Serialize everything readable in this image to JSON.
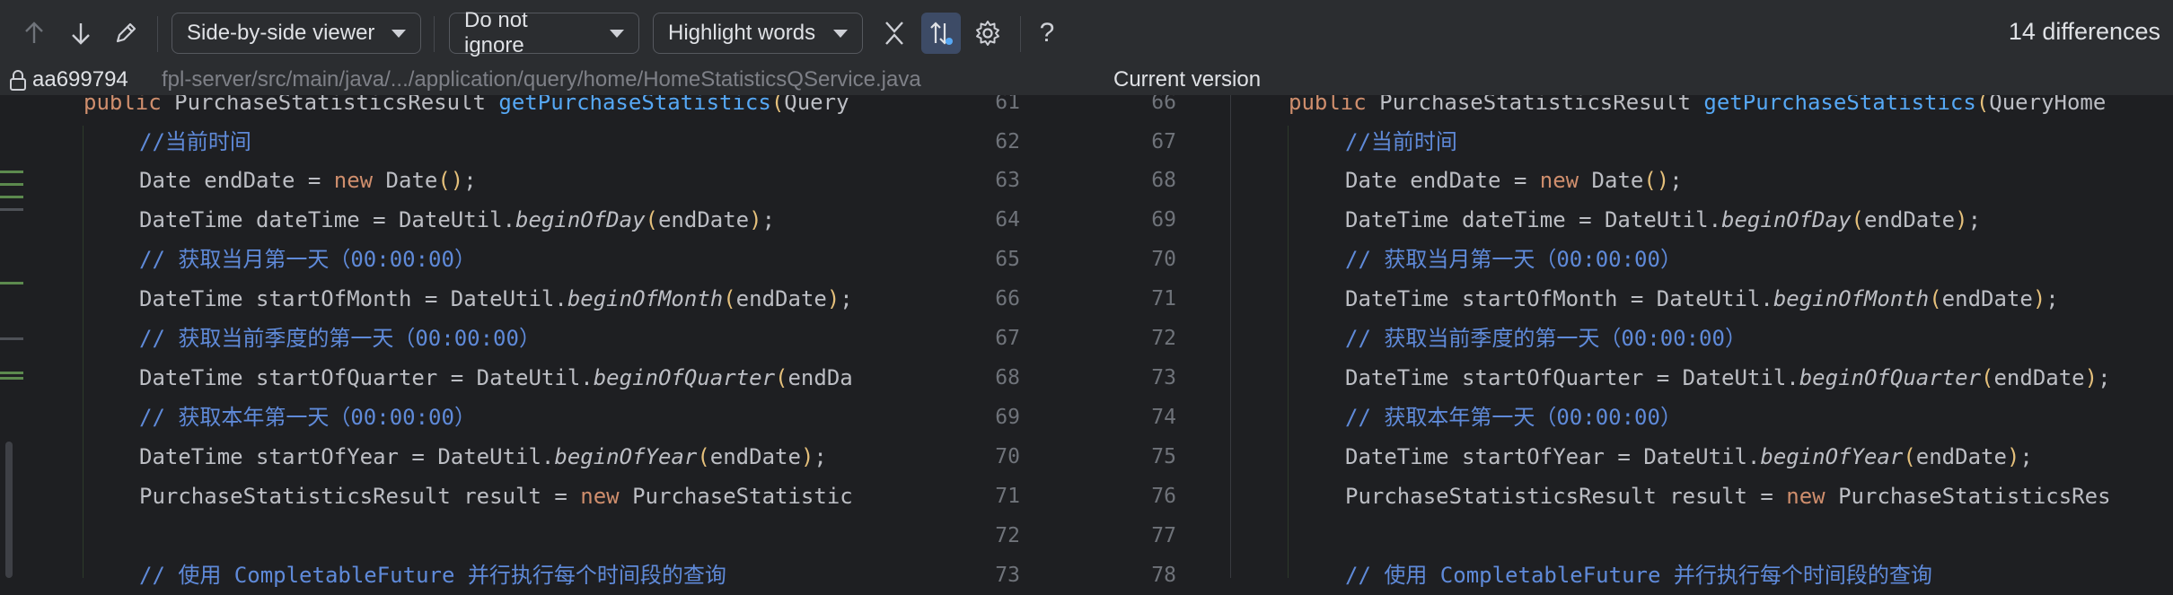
{
  "toolbar": {
    "viewer_mode": "Side-by-side viewer",
    "ignore_mode": "Do not ignore",
    "highlight_mode": "Highlight words",
    "help_label": "?",
    "diff_count": "14 differences"
  },
  "pathbar": {
    "revision": "aa699794",
    "path": "fpl-server/src/main/java/.../application/query/home/HomeStatisticsQService.java",
    "current_label": "Current version"
  },
  "colors": {
    "background": "#1e1f22",
    "toolbar": "#2b2d30",
    "keyword": "#cf8e6d",
    "function": "#56a8f5",
    "comment": "#5f8ad9",
    "bracket": "#e5c07b"
  },
  "left_lines": [
    "61",
    "62",
    "63",
    "64",
    "65",
    "66",
    "67",
    "68",
    "69",
    "70",
    "71",
    "72",
    "73"
  ],
  "right_lines": [
    "66",
    "67",
    "68",
    "69",
    "70",
    "71",
    "72",
    "73",
    "74",
    "75",
    "76",
    "77",
    "78"
  ],
  "code": {
    "l0": {
      "kw": "public",
      "pre": " PurchaseStatisticsResult ",
      "fn": "getPurchaseStatistics",
      "br": "(",
      "post_left": "Query",
      "post_right": "QueryHome"
    },
    "l1": {
      "cm": "//当前时间"
    },
    "l2": {
      "pre": "Date endDate = ",
      "kw": "new",
      "mid": " Date",
      "br": "()",
      "post": ";"
    },
    "l3": {
      "pre": "DateTime dateTime = DateUtil.",
      "it": "beginOfDay",
      "br1": "(",
      "arg": "endDate",
      "br2": ")",
      "post": ";"
    },
    "l4": {
      "cm": "// 获取当月第一天（00:00:00）"
    },
    "l5": {
      "pre": "DateTime startOfMonth = DateUtil.",
      "it": "beginOfMonth",
      "br1": "(",
      "arg": "endDate",
      "br2": ")",
      "post": ";"
    },
    "l6": {
      "cm": "// 获取当前季度的第一天（00:00:00）"
    },
    "l7": {
      "pre": "DateTime startOfQuarter = DateUtil.",
      "it": "beginOfQuarter",
      "br1": "(",
      "arg_left": "endDa",
      "arg_right": "endDate",
      "br2": ")",
      "post": ";"
    },
    "l8": {
      "cm": "// 获取本年第一天（00:00:00）"
    },
    "l9": {
      "pre": "DateTime startOfYear = DateUtil.",
      "it": "beginOfYear",
      "br1": "(",
      "arg": "endDate",
      "br2": ")",
      "post": ";"
    },
    "l10": {
      "pre": "PurchaseStatisticsResult result = ",
      "kw": "new",
      "post_left": " PurchaseStatistic",
      "post_right": " PurchaseStatisticsRes"
    },
    "l12": {
      "cm": "// 使用 CompletableFuture 并行执行每个时间段的查询"
    }
  }
}
